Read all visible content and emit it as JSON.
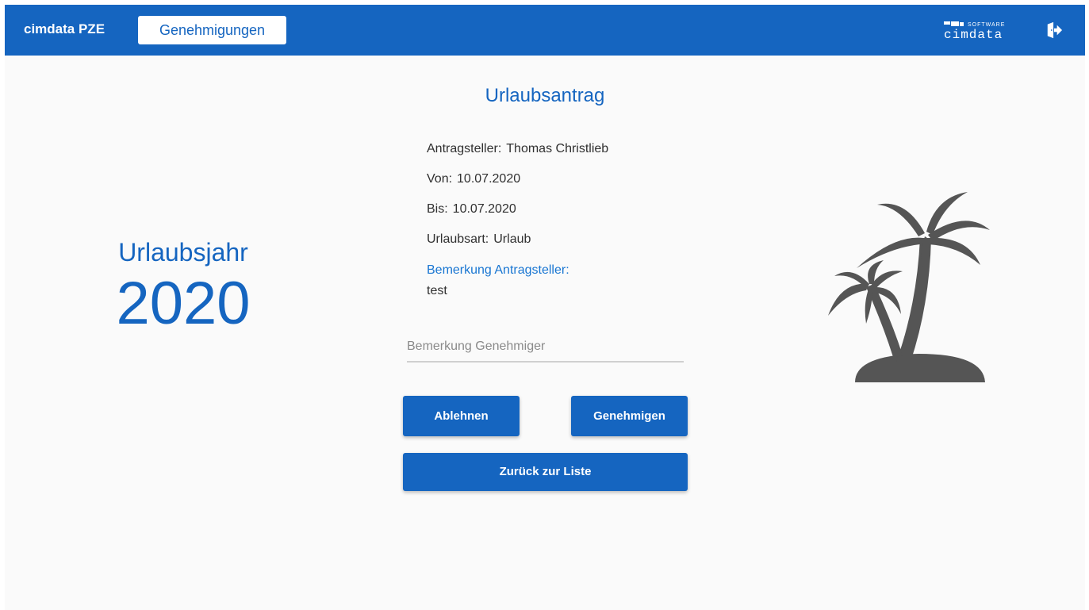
{
  "header": {
    "app_title": "cimdata PZE",
    "nav_button_label": "Genehmigungen",
    "brand_small": "SOFTWARE",
    "brand_main": "cimdata",
    "bar_color": "#1565c0"
  },
  "year": {
    "label": "Urlaubsjahr",
    "value": "2020"
  },
  "form": {
    "title": "Urlaubsantrag",
    "fields": [
      {
        "key": "Antragsteller:",
        "value": "Thomas Christlieb"
      },
      {
        "key": "Von:",
        "value": "10.07.2020"
      },
      {
        "key": "Bis:",
        "value": "10.07.2020"
      },
      {
        "key": "Urlaubsart:",
        "value": "Urlaub"
      }
    ],
    "remark_label": "Bemerkung Antragsteller:",
    "remark_text": "test",
    "approver_remark_placeholder": "Bemerkung Genehmiger",
    "approver_remark_value": ""
  },
  "actions": {
    "reject_label": "Ablehnen",
    "approve_label": "Genehmigen",
    "back_label": "Zurück zur Liste"
  },
  "icons": {
    "logout": "logout-icon",
    "illustration": "palm-trees-icon"
  },
  "colors": {
    "accent": "#1565c0",
    "illustration": "#555555",
    "background": "#fafafa"
  }
}
